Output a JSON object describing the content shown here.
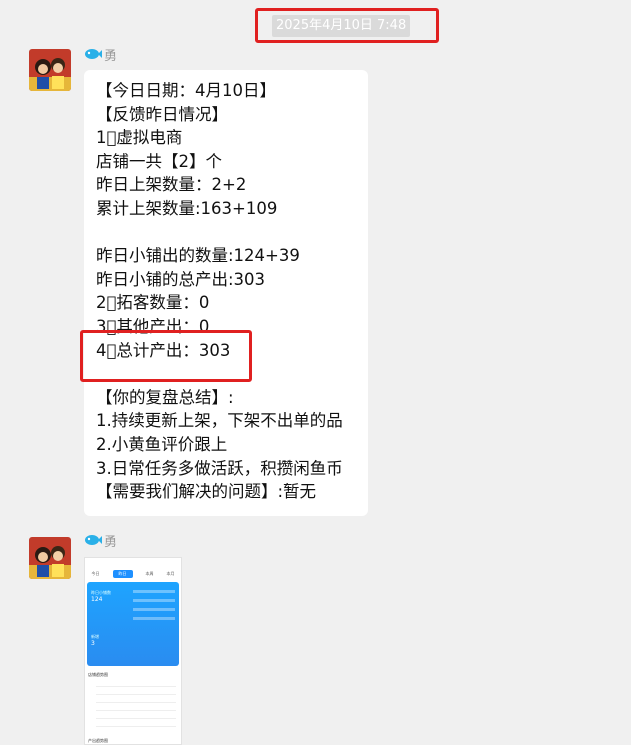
{
  "timestamp": "2025年4月10日 7:48",
  "messages": [
    {
      "sender": "勇",
      "lines": [
        "【今日日期：4月10日】",
        "【反馈昨日情况】",
        "1⃣虚拟电商",
        "店铺一共【2】个",
        "昨日上架数量：2+2",
        "累计上架数量:163+109",
        "",
        "昨日小铺出的数量:124+39",
        "昨日小铺的总产出:303",
        "2⃣拓客数量：0",
        "3⃣其他产出：0",
        "4⃣总计产出：303",
        "",
        "【你的复盘总结】:",
        "1.持续更新上架，下架不出单的品",
        "2.小黄鱼评价跟上",
        "3.日常任务多做活跃，积攒闲鱼币",
        "【需要我们解决的问题】:暂无"
      ]
    },
    {
      "sender": "勇",
      "image": {
        "tabs": [
          "今日",
          "昨日",
          "本周",
          "本月"
        ],
        "active_tab": "昨日",
        "card_label_1": "昨日小铺数",
        "card_value_1": "124",
        "card_label_2": "新增",
        "card_value_2": "3",
        "section_1": "店铺趋势图",
        "section_2": "产出趋势图"
      }
    }
  ],
  "colors": {
    "highlight": "#e02020",
    "bubble": "#ffffff",
    "background": "#f0f0f0"
  }
}
